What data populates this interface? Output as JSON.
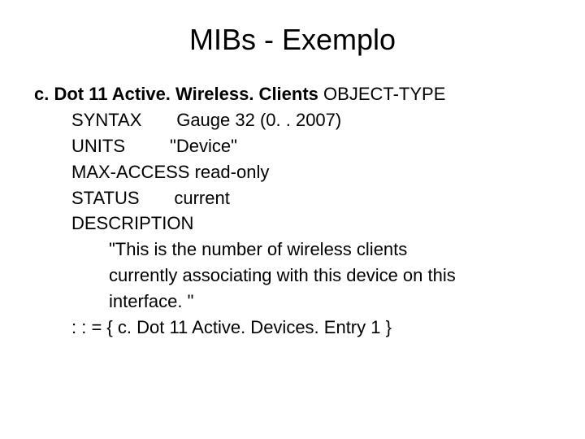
{
  "title": "MIBs - Exemplo",
  "mib": {
    "object_name": "c. Dot 11 Active. Wireless. Clients",
    "object_type_keyword": "OBJECT-TYPE",
    "syntax_label": "SYNTAX",
    "syntax_value": "Gauge 32 (0. . 2007)",
    "units_label": "UNITS",
    "units_value": "\"Device\"",
    "max_access_label": "MAX-ACCESS",
    "max_access_value": "read-only",
    "status_label": "STATUS",
    "status_value": "current",
    "description_label": "DESCRIPTION",
    "description_line1": "\"This is the number of wireless clients",
    "description_line2": "currently associating with this device on this",
    "description_line3": "interface. \"",
    "assignment": ": : = { c. Dot 11 Active. Devices. Entry 1 }"
  }
}
